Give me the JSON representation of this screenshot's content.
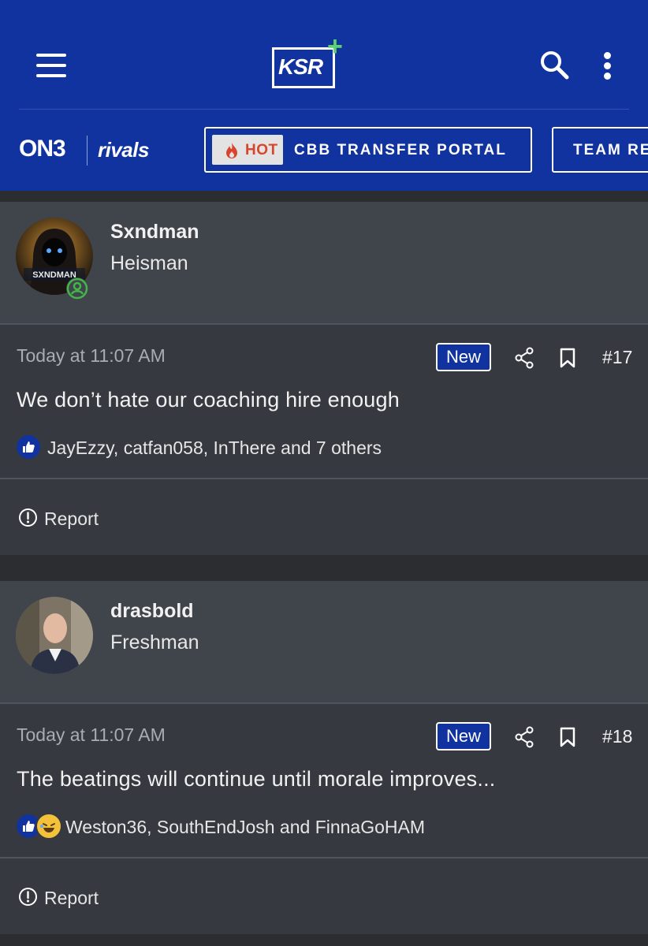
{
  "header": {
    "logo_text": "KSR",
    "logo_plus": "+",
    "brand_left": "ON3",
    "brand_right": "rivals",
    "nav": [
      {
        "badge": "HOT",
        "label": "CBB TRANSFER PORTAL"
      },
      {
        "label": "TEAM RE"
      }
    ],
    "accent_color": "#1133a0"
  },
  "posts": [
    {
      "username": "Sxndman",
      "user_title": "Heisman",
      "avatar_text": "SXNDMAN",
      "online": true,
      "timestamp": "Today at 11:07 AM",
      "badge": "New",
      "number": "#17",
      "message": "We don’t hate our coaching hire enough",
      "reactions": [
        "like-icon"
      ],
      "reaction_names": "JayEzzy, catfan058, InThere and 7 others",
      "report_label": "Report"
    },
    {
      "username": "drasbold",
      "user_title": "Freshman",
      "online": false,
      "timestamp": "Today at 11:07 AM",
      "badge": "New",
      "number": "#18",
      "message": "The beatings will continue until morale improves...",
      "reactions": [
        "like-icon",
        "laughing-emoji-icon"
      ],
      "reaction_names": "Weston36, SouthEndJosh and FinnaGoHAM",
      "report_label": "Report"
    }
  ]
}
